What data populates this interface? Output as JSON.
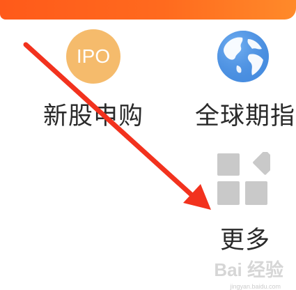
{
  "menu": {
    "items": [
      {
        "label": "新股申购",
        "icon_text": "IPO",
        "icon": "ipo-icon"
      },
      {
        "label": "全球期指",
        "icon": "globe-icon"
      },
      {
        "label": "更多",
        "icon": "grid-more-icon"
      }
    ]
  },
  "watermark": {
    "text": "Bai 经验",
    "sub": "jingyan.baidu.com"
  },
  "colors": {
    "top_bar": "#ff5a1a",
    "ipo_icon_bg": "#f5bb6c",
    "globe_blue": "#4a90e2",
    "arrow": "#f2321e",
    "more_tiles": "#c9c9c9"
  }
}
